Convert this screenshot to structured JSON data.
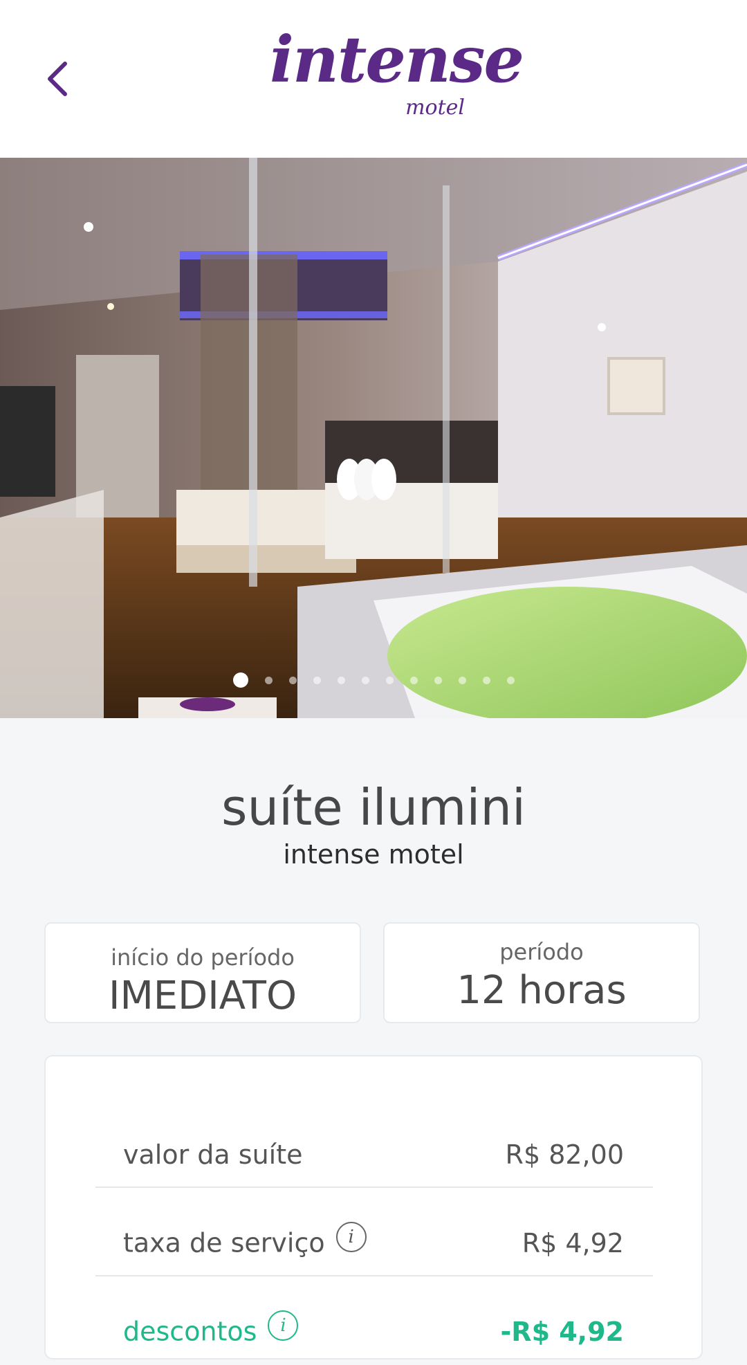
{
  "header": {
    "back_icon": "chevron-left-icon",
    "logo_text": "intense",
    "logo_sub": "motel",
    "accent_color": "#5b2a86"
  },
  "gallery": {
    "image_description": "suite photo",
    "total_slides": 12,
    "active_slide": 1
  },
  "suite": {
    "name": "suíte ilumini",
    "motel": "intense motel"
  },
  "period_start": {
    "label": "início do período",
    "value": "IMEDIATO"
  },
  "period": {
    "label": "período",
    "value": "12 horas"
  },
  "pricing": {
    "rows": [
      {
        "label": "valor da suíte",
        "value": "R$ 82,00",
        "info": false
      },
      {
        "label": "taxa de serviço",
        "value": "R$ 4,92",
        "info": true,
        "icon": "info-icon"
      },
      {
        "label": "descontos",
        "value": "-R$ 4,92",
        "info": true,
        "icon": "info-icon",
        "color": "#1fb88a"
      }
    ]
  }
}
